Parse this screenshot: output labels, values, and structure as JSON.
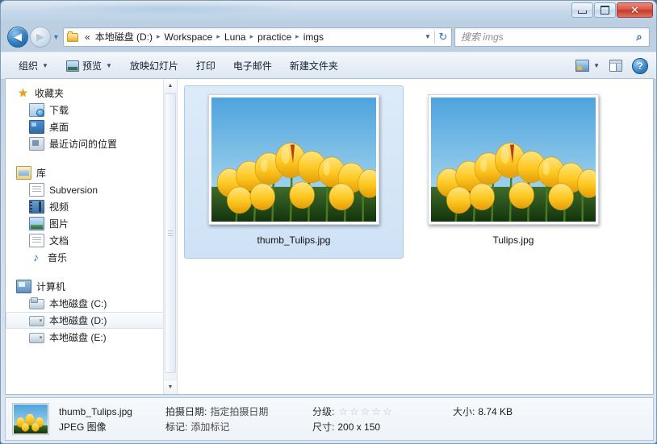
{
  "window": {
    "title": "",
    "controls": {
      "minimize": "—",
      "maximize": "□",
      "close": "✕"
    }
  },
  "addressbar": {
    "back_icon": "◀",
    "forward_icon": "▶",
    "history_caret": "▼",
    "folder_icon": "folder-icon",
    "overflow": "«",
    "crumbs": [
      "本地磁盘 (D:)",
      "Workspace",
      "Luna",
      "practice",
      "imgs"
    ],
    "separator": "▸",
    "dropdown_caret": "▼",
    "refresh_icon": "↻"
  },
  "search": {
    "placeholder": "搜索 imgs",
    "icon": "search-icon"
  },
  "toolbar": {
    "organize": "组织",
    "preview": "预览",
    "slideshow": "放映幻灯片",
    "print": "打印",
    "email": "电子邮件",
    "new_folder": "新建文件夹",
    "caret": "▼",
    "help": "?"
  },
  "sidebar": {
    "groups": [
      {
        "header": {
          "label": "收藏夹",
          "icon": "star-icon"
        },
        "items": [
          {
            "label": "下载",
            "icon": "download-icon"
          },
          {
            "label": "桌面",
            "icon": "desktop-icon"
          },
          {
            "label": "最近访问的位置",
            "icon": "recent-places-icon"
          }
        ]
      },
      {
        "header": {
          "label": "库",
          "icon": "library-icon"
        },
        "items": [
          {
            "label": "Subversion",
            "icon": "document-icon"
          },
          {
            "label": "视频",
            "icon": "video-icon"
          },
          {
            "label": "图片",
            "icon": "pictures-icon"
          },
          {
            "label": "文档",
            "icon": "document-icon"
          },
          {
            "label": "音乐",
            "icon": "music-icon"
          }
        ]
      },
      {
        "header": {
          "label": "计算机",
          "icon": "computer-icon"
        },
        "items": [
          {
            "label": "本地磁盘 (C:)",
            "icon": "system-drive-icon",
            "selected": false
          },
          {
            "label": "本地磁盘 (D:)",
            "icon": "drive-icon",
            "selected": true
          },
          {
            "label": "本地磁盘 (E:)",
            "icon": "drive-icon",
            "selected": false
          }
        ]
      }
    ],
    "scrollbar": {
      "up": "▲",
      "down": "▼"
    }
  },
  "files": [
    {
      "name": "thumb_Tulips.jpg",
      "selected": true
    },
    {
      "name": "Tulips.jpg",
      "selected": false
    }
  ],
  "details": {
    "filename": "thumb_Tulips.jpg",
    "filetype": "JPEG 图像",
    "date_key": "拍摄日期:",
    "date_value": "指定拍摄日期",
    "tags_key": "标记:",
    "tags_value": "添加标记",
    "rating_key": "分级:",
    "rating_stars": 5,
    "rating_filled": 0,
    "star_glyph": "☆",
    "dimensions_key": "尺寸:",
    "dimensions_value": "200 x 150",
    "size_key": "大小:",
    "size_value": "8.74 KB"
  },
  "colors": {
    "selection": "#cfe2f5",
    "selection_border": "#a8c8e6",
    "close_button": "#c33a2c",
    "accent": "#2f7cc0"
  }
}
